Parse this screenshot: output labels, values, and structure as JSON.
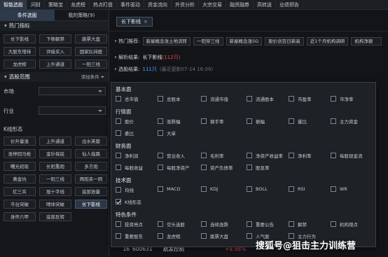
{
  "topnav": {
    "tabs": [
      "智能选股",
      "问财",
      "策略宝",
      "龙虎榜",
      "热点盯盘",
      "事件驱动",
      "资金流向",
      "外资分析",
      "大宗交易",
      "融资融券",
      "高转送",
      "业绩预告"
    ]
  },
  "left": {
    "subtabs": [
      "条件选股",
      "我的策略(9)"
    ],
    "hot_title": "热门指标",
    "hot_items": [
      "长下影线",
      "下移解禁",
      "跳票大盘",
      "大股东增持",
      "评级买入",
      "国家队持股",
      "龙虎榜",
      "上升通道",
      "一阳三线"
    ],
    "range_title": "选股范围",
    "add_condition": "添加条件",
    "market_label": "市场",
    "industry_label": "行业",
    "k_title": "K线形态",
    "k_items": [
      "价升量涨",
      "上升通道",
      "出水芙蓉",
      "涨停回马枪",
      "金针探底",
      "仙人指路",
      "曙光初现",
      "长阳重炮",
      "多方炮",
      "黄金坑",
      "一阳三线",
      "两阳夹一阴",
      "红三兵",
      "旭十字线",
      "底部放量",
      "平台突破",
      "晴体突破",
      "长下影线",
      "身怀六甲",
      "底部反转"
    ],
    "k_selected": "长下影线"
  },
  "main": {
    "chip_label": "长下影线",
    "hot_label": "热门推荐:",
    "hot_recs": [
      "新屋概念涨土地流转",
      "一阳穿三线",
      "新屋概念涨5G",
      "股价创百日新高",
      "近1个月机构调研",
      "机构净额"
    ],
    "parse_label": "解析结果:",
    "parse_value": "长下影线",
    "parse_count": "(112只)",
    "result_label": "选股结果:",
    "result_value": "111只",
    "result_time": "(最近更新07-14 16:39)",
    "bottom_row": {
      "num": "16",
      "code": "600631",
      "name": "航发控制",
      "pct": "+9.98%"
    }
  },
  "popup": {
    "groups": [
      {
        "title": "基本面",
        "rows": [
          [
            "总市值",
            "总股本",
            "流通市值",
            "流通股本",
            "市盈率",
            "市净率"
          ]
        ]
      },
      {
        "title": "行情面",
        "rows": [
          [
            "股价",
            "涨跌幅",
            "换手率",
            "振幅",
            "量比",
            "主力资金"
          ],
          [
            "委比",
            "大单"
          ]
        ]
      },
      {
        "title": "财务面",
        "rows": [
          [
            "净利润",
            "营业收入",
            "毛利率",
            "净资产收益率",
            "净利率",
            "每股现金流"
          ],
          [
            "每股收益",
            "每股净资产",
            "资产负债率",
            "股息率"
          ]
        ]
      },
      {
        "title": "技术面",
        "rows": [
          [
            "均线",
            "MACD",
            "KDJ",
            "BOLL",
            "RSI",
            "WR"
          ],
          [
            "K线形态"
          ]
        ]
      },
      {
        "title": "特色条件",
        "rows": [
          [
            "投资亮点",
            "空头选股",
            "连续涨跌",
            "重要公告",
            "解禁",
            "机构观点"
          ],
          [
            "重要股东",
            "龙虎榜",
            "跳票大盘",
            "人气股",
            "主力行为"
          ]
        ]
      }
    ],
    "checked": [
      "K线形态"
    ]
  },
  "watermark": "搜狐号@狙击主力训练营"
}
